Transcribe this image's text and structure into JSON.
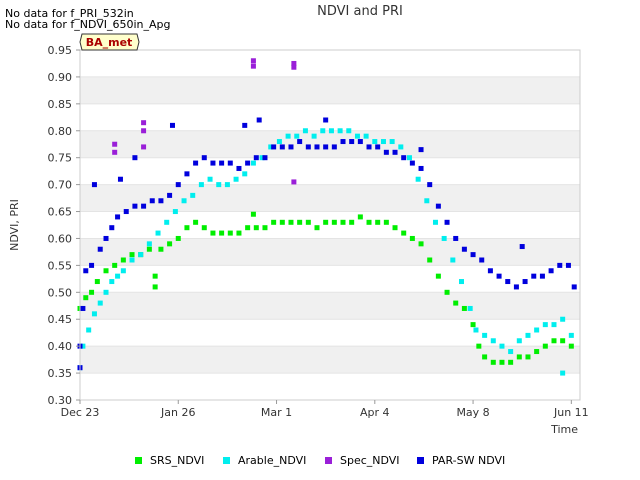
{
  "notes": [
    "No data for f_PRI_532in",
    "No data for f_NDVI_650in_Apg"
  ],
  "badge": "BA_met",
  "colors": {
    "SRS_NDVI": "#00ee00",
    "Arable_NDVI": "#00eeee",
    "Spec_NDVI": "#9a1fd8",
    "PAR_SW_NDVI": "#0000dd"
  },
  "chart_data": {
    "type": "scatter",
    "title": "NDVI and PRI",
    "xlabel": "Time",
    "ylabel": "NDVI, PRI",
    "ylim": [
      0.3,
      0.95
    ],
    "xlim": [
      "2023-12-23",
      "2024-06-13"
    ],
    "x_ticks": [
      "Dec 23",
      "Jan 26",
      "Mar 1",
      "Apr 4",
      "May 8",
      "Jun 11"
    ],
    "y_ticks": [
      "0.30",
      "0.35",
      "0.40",
      "0.45",
      "0.50",
      "0.55",
      "0.60",
      "0.65",
      "0.70",
      "0.75",
      "0.80",
      "0.85",
      "0.90",
      "0.95"
    ],
    "grid": true,
    "legend_position": "bottom",
    "series": [
      {
        "name": "SRS_NDVI",
        "points": [
          [
            "2023-12-23",
            0.47
          ],
          [
            "2023-12-25",
            0.49
          ],
          [
            "2023-12-27",
            0.5
          ],
          [
            "2023-12-29",
            0.52
          ],
          [
            "2024-01-01",
            0.54
          ],
          [
            "2024-01-04",
            0.55
          ],
          [
            "2024-01-07",
            0.56
          ],
          [
            "2024-01-10",
            0.57
          ],
          [
            "2024-01-13",
            0.57
          ],
          [
            "2024-01-16",
            0.58
          ],
          [
            "2024-01-18",
            0.53
          ],
          [
            "2024-01-18",
            0.51
          ],
          [
            "2024-01-20",
            0.58
          ],
          [
            "2024-01-23",
            0.59
          ],
          [
            "2024-01-26",
            0.6
          ],
          [
            "2024-01-29",
            0.62
          ],
          [
            "2024-02-01",
            0.63
          ],
          [
            "2024-02-04",
            0.62
          ],
          [
            "2024-02-07",
            0.61
          ],
          [
            "2024-02-10",
            0.61
          ],
          [
            "2024-02-13",
            0.61
          ],
          [
            "2024-02-16",
            0.61
          ],
          [
            "2024-02-19",
            0.62
          ],
          [
            "2024-02-21",
            0.645
          ],
          [
            "2024-02-22",
            0.62
          ],
          [
            "2024-02-25",
            0.62
          ],
          [
            "2024-02-28",
            0.63
          ],
          [
            "2024-03-02",
            0.63
          ],
          [
            "2024-03-05",
            0.63
          ],
          [
            "2024-03-08",
            0.63
          ],
          [
            "2024-03-11",
            0.63
          ],
          [
            "2024-03-14",
            0.62
          ],
          [
            "2024-03-17",
            0.63
          ],
          [
            "2024-03-20",
            0.63
          ],
          [
            "2024-03-23",
            0.63
          ],
          [
            "2024-03-26",
            0.63
          ],
          [
            "2024-03-29",
            0.64
          ],
          [
            "2024-04-01",
            0.63
          ],
          [
            "2024-04-04",
            0.63
          ],
          [
            "2024-04-07",
            0.63
          ],
          [
            "2024-04-10",
            0.62
          ],
          [
            "2024-04-13",
            0.61
          ],
          [
            "2024-04-16",
            0.6
          ],
          [
            "2024-04-19",
            0.59
          ],
          [
            "2024-04-22",
            0.56
          ],
          [
            "2024-04-25",
            0.53
          ],
          [
            "2024-04-28",
            0.5
          ],
          [
            "2024-05-01",
            0.48
          ],
          [
            "2024-05-04",
            0.47
          ],
          [
            "2024-05-07",
            0.44
          ],
          [
            "2024-05-09",
            0.4
          ],
          [
            "2024-05-11",
            0.38
          ],
          [
            "2024-05-14",
            0.37
          ],
          [
            "2024-05-17",
            0.37
          ],
          [
            "2024-05-20",
            0.37
          ],
          [
            "2024-05-23",
            0.38
          ],
          [
            "2024-05-26",
            0.38
          ],
          [
            "2024-05-29",
            0.39
          ],
          [
            "2024-06-01",
            0.4
          ],
          [
            "2024-06-04",
            0.41
          ],
          [
            "2024-06-07",
            0.41
          ],
          [
            "2024-06-10",
            0.4
          ]
        ]
      },
      {
        "name": "Arable_NDVI",
        "points": [
          [
            "2023-12-23",
            0.36
          ],
          [
            "2023-12-24",
            0.4
          ],
          [
            "2023-12-26",
            0.43
          ],
          [
            "2023-12-28",
            0.46
          ],
          [
            "2023-12-30",
            0.48
          ],
          [
            "2024-01-01",
            0.5
          ],
          [
            "2024-01-03",
            0.52
          ],
          [
            "2024-01-05",
            0.53
          ],
          [
            "2024-01-07",
            0.54
          ],
          [
            "2024-01-10",
            0.56
          ],
          [
            "2024-01-13",
            0.57
          ],
          [
            "2024-01-16",
            0.59
          ],
          [
            "2024-01-19",
            0.61
          ],
          [
            "2024-01-22",
            0.63
          ],
          [
            "2024-01-25",
            0.65
          ],
          [
            "2024-01-28",
            0.67
          ],
          [
            "2024-01-31",
            0.68
          ],
          [
            "2024-02-03",
            0.7
          ],
          [
            "2024-02-06",
            0.71
          ],
          [
            "2024-02-09",
            0.7
          ],
          [
            "2024-02-12",
            0.7
          ],
          [
            "2024-02-15",
            0.71
          ],
          [
            "2024-02-18",
            0.72
          ],
          [
            "2024-02-21",
            0.74
          ],
          [
            "2024-02-24",
            0.75
          ],
          [
            "2024-02-27",
            0.77
          ],
          [
            "2024-03-01",
            0.78
          ],
          [
            "2024-03-04",
            0.79
          ],
          [
            "2024-03-07",
            0.79
          ],
          [
            "2024-03-10",
            0.8
          ],
          [
            "2024-03-13",
            0.79
          ],
          [
            "2024-03-16",
            0.8
          ],
          [
            "2024-03-19",
            0.8
          ],
          [
            "2024-03-22",
            0.8
          ],
          [
            "2024-03-25",
            0.8
          ],
          [
            "2024-03-28",
            0.79
          ],
          [
            "2024-03-31",
            0.79
          ],
          [
            "2024-04-03",
            0.78
          ],
          [
            "2024-04-06",
            0.78
          ],
          [
            "2024-04-09",
            0.78
          ],
          [
            "2024-04-12",
            0.77
          ],
          [
            "2024-04-15",
            0.75
          ],
          [
            "2024-04-18",
            0.71
          ],
          [
            "2024-04-21",
            0.67
          ],
          [
            "2024-04-24",
            0.63
          ],
          [
            "2024-04-27",
            0.6
          ],
          [
            "2024-04-30",
            0.56
          ],
          [
            "2024-05-03",
            0.52
          ],
          [
            "2024-05-06",
            0.47
          ],
          [
            "2024-05-08",
            0.43
          ],
          [
            "2024-05-11",
            0.42
          ],
          [
            "2024-05-14",
            0.41
          ],
          [
            "2024-05-17",
            0.4
          ],
          [
            "2024-05-20",
            0.39
          ],
          [
            "2024-05-23",
            0.41
          ],
          [
            "2024-05-26",
            0.42
          ],
          [
            "2024-05-29",
            0.43
          ],
          [
            "2024-06-01",
            0.44
          ],
          [
            "2024-06-04",
            0.44
          ],
          [
            "2024-06-07",
            0.45
          ],
          [
            "2024-06-10",
            0.42
          ],
          [
            "2024-06-07",
            0.35
          ]
        ]
      },
      {
        "name": "Spec_NDVI",
        "points": [
          [
            "2024-01-04",
            0.775
          ],
          [
            "2024-01-04",
            0.76
          ],
          [
            "2024-01-14",
            0.815
          ],
          [
            "2024-01-14",
            0.8
          ],
          [
            "2024-01-14",
            0.77
          ],
          [
            "2024-02-21",
            0.93
          ],
          [
            "2024-02-21",
            0.92
          ],
          [
            "2024-03-06",
            0.925
          ],
          [
            "2024-03-06",
            0.918
          ],
          [
            "2024-03-06",
            0.705
          ]
        ]
      },
      {
        "name": "PAR-SW NDVI",
        "points": [
          [
            "2023-12-23",
            0.36
          ],
          [
            "2023-12-23",
            0.4
          ],
          [
            "2023-12-24",
            0.47
          ],
          [
            "2023-12-25",
            0.54
          ],
          [
            "2023-12-27",
            0.55
          ],
          [
            "2023-12-28",
            0.7
          ],
          [
            "2023-12-30",
            0.58
          ],
          [
            "2024-01-01",
            0.6
          ],
          [
            "2024-01-03",
            0.62
          ],
          [
            "2024-01-05",
            0.64
          ],
          [
            "2024-01-06",
            0.71
          ],
          [
            "2024-01-08",
            0.65
          ],
          [
            "2024-01-11",
            0.66
          ],
          [
            "2024-01-14",
            0.66
          ],
          [
            "2024-01-17",
            0.67
          ],
          [
            "2024-01-20",
            0.67
          ],
          [
            "2024-01-23",
            0.68
          ],
          [
            "2024-01-26",
            0.7
          ],
          [
            "2024-01-29",
            0.72
          ],
          [
            "2024-02-01",
            0.74
          ],
          [
            "2024-02-04",
            0.75
          ],
          [
            "2024-02-07",
            0.74
          ],
          [
            "2024-02-10",
            0.74
          ],
          [
            "2024-02-13",
            0.74
          ],
          [
            "2024-02-16",
            0.73
          ],
          [
            "2024-02-19",
            0.74
          ],
          [
            "2024-02-22",
            0.75
          ],
          [
            "2024-02-25",
            0.75
          ],
          [
            "2024-02-28",
            0.77
          ],
          [
            "2024-03-02",
            0.77
          ],
          [
            "2024-03-05",
            0.77
          ],
          [
            "2024-03-08",
            0.78
          ],
          [
            "2024-03-11",
            0.77
          ],
          [
            "2024-03-14",
            0.77
          ],
          [
            "2024-03-17",
            0.77
          ],
          [
            "2024-03-20",
            0.77
          ],
          [
            "2024-03-23",
            0.78
          ],
          [
            "2024-03-26",
            0.78
          ],
          [
            "2024-03-29",
            0.78
          ],
          [
            "2024-04-01",
            0.77
          ],
          [
            "2024-04-04",
            0.77
          ],
          [
            "2024-04-07",
            0.76
          ],
          [
            "2024-04-10",
            0.76
          ],
          [
            "2024-04-13",
            0.75
          ],
          [
            "2024-04-16",
            0.74
          ],
          [
            "2024-04-19",
            0.73
          ],
          [
            "2024-04-22",
            0.7
          ],
          [
            "2024-04-25",
            0.66
          ],
          [
            "2024-04-28",
            0.63
          ],
          [
            "2024-05-01",
            0.6
          ],
          [
            "2024-05-04",
            0.58
          ],
          [
            "2024-05-07",
            0.57
          ],
          [
            "2024-05-10",
            0.56
          ],
          [
            "2024-05-13",
            0.54
          ],
          [
            "2024-05-16",
            0.53
          ],
          [
            "2024-05-19",
            0.52
          ],
          [
            "2024-05-22",
            0.51
          ],
          [
            "2024-05-24",
            0.585
          ],
          [
            "2024-05-25",
            0.52
          ],
          [
            "2024-05-28",
            0.53
          ],
          [
            "2024-05-31",
            0.53
          ],
          [
            "2024-06-03",
            0.54
          ],
          [
            "2024-06-06",
            0.55
          ],
          [
            "2024-06-09",
            0.55
          ],
          [
            "2024-06-11",
            0.51
          ],
          [
            "2024-01-24",
            0.81
          ],
          [
            "2024-02-18",
            0.81
          ],
          [
            "2024-02-23",
            0.82
          ],
          [
            "2024-03-17",
            0.82
          ],
          [
            "2024-04-19",
            0.765
          ],
          [
            "2024-01-11",
            0.75
          ]
        ]
      }
    ]
  }
}
